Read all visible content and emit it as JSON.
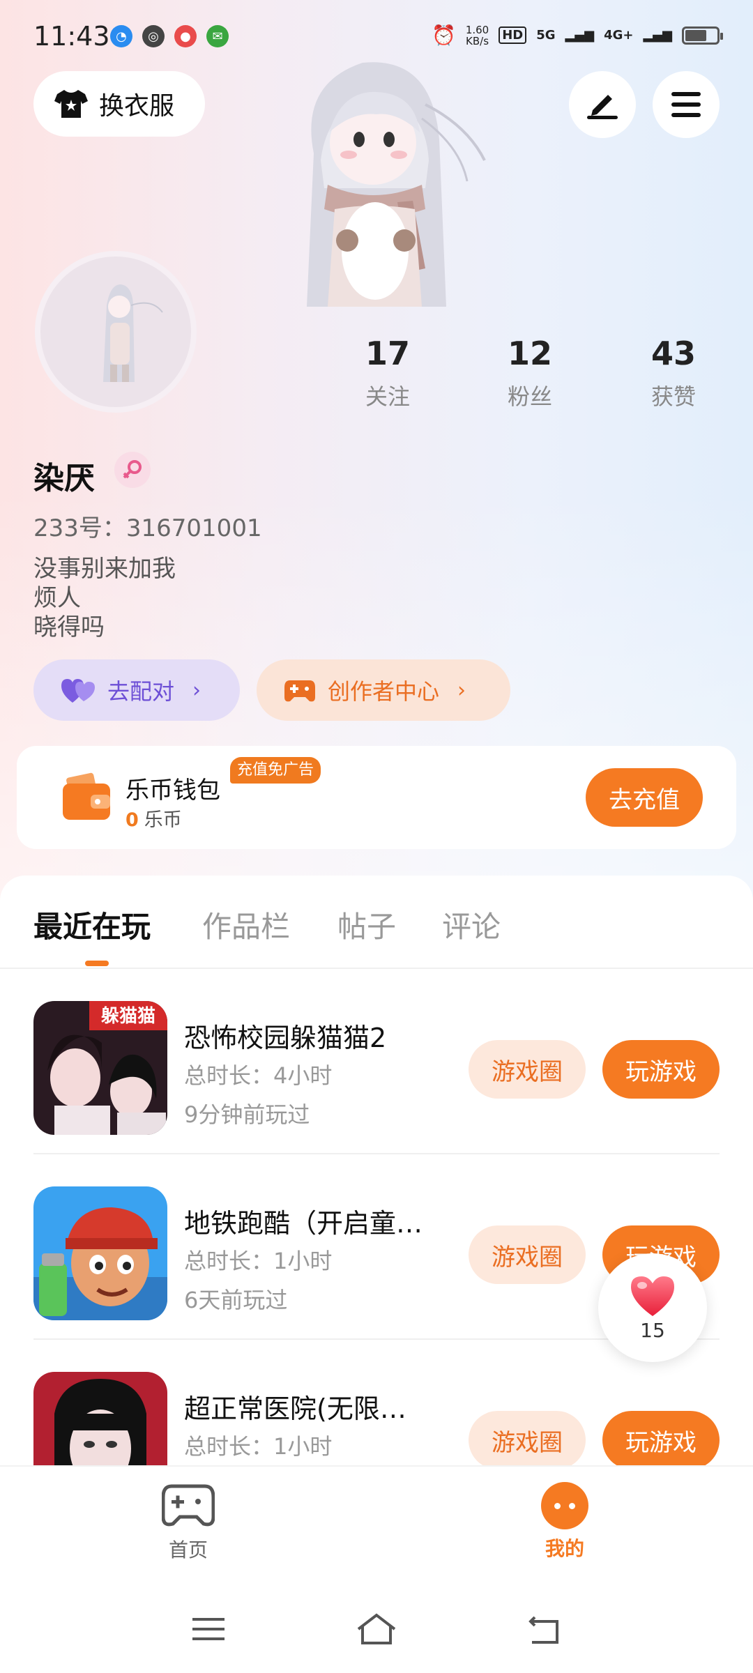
{
  "status_bar": {
    "time": "11:43",
    "net_speed_value": "1.60",
    "net_speed_unit": "KB/s",
    "hd_label": "HD",
    "signal_5g": "5G",
    "signal_4g": "4G+"
  },
  "header": {
    "costume_label": "换衣服"
  },
  "profile": {
    "username": "染厌",
    "uid_text": "233号：316701001",
    "bio_lines": [
      "没事别来加我",
      "烦人",
      "晓得吗"
    ],
    "stats": [
      {
        "value": "17",
        "label": "关注"
      },
      {
        "value": "12",
        "label": "粉丝"
      },
      {
        "value": "43",
        "label": "获赞"
      }
    ],
    "pair_label": "去配对",
    "creator_label": "创作者中心"
  },
  "wallet": {
    "title": "乐币钱包",
    "balance": "0",
    "currency": "乐币",
    "ad_badge": "充值免广告",
    "recharge_label": "去充值"
  },
  "tabs": [
    "最近在玩",
    "作品栏",
    "帖子",
    "评论"
  ],
  "games": [
    {
      "name": "恐怖校园躲猫猫2",
      "thumb_text": "躲猫猫",
      "duration": "总时长：4小时",
      "last_played": "9分钟前玩过",
      "circle_label": "游戏圈",
      "play_label": "玩游戏"
    },
    {
      "name": "地铁跑酷（开启童…",
      "thumb_text": "",
      "duration": "总时长：1小时",
      "last_played": "6天前玩过",
      "circle_label": "游戏圈",
      "play_label": "玩游戏"
    },
    {
      "name": "超正常医院(无限…",
      "thumb_text": "",
      "duration": "总时长：1小时",
      "last_played": "",
      "circle_label": "游戏圈",
      "play_label": "玩游戏"
    }
  ],
  "like_float": {
    "count": "15"
  },
  "bottom_nav": {
    "home_label": "首页",
    "me_label": "我的"
  },
  "colors": {
    "accent": "#f57a22",
    "pair_purple": "#6d4fd6"
  }
}
